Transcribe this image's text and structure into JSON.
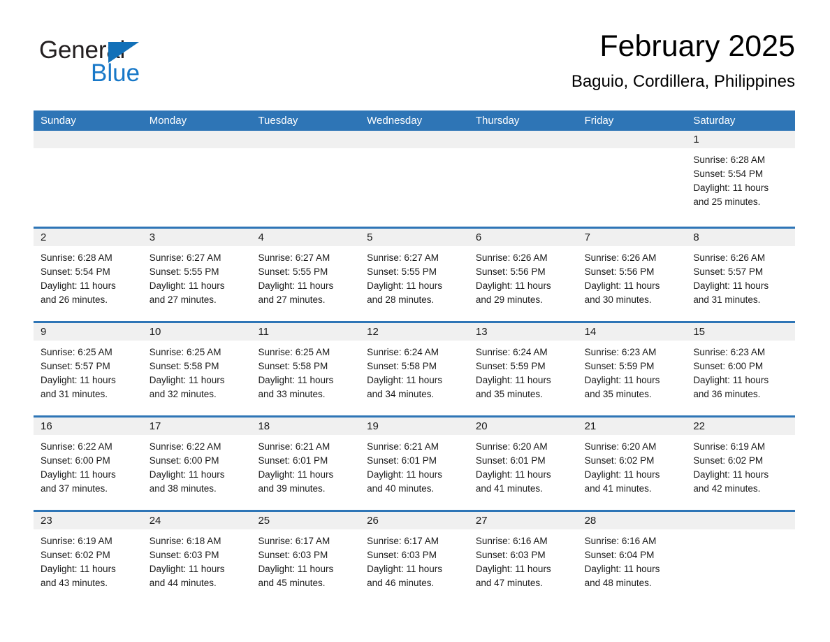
{
  "brand": {
    "name_part1": "General",
    "name_part2": "Blue",
    "logo_icon": "general-blue-triangle-logo"
  },
  "header": {
    "month_title": "February 2025",
    "location": "Baguio, Cordillera, Philippines"
  },
  "colors": {
    "header_blue": "#2e75b6",
    "brand_blue": "#1878c8",
    "day_number_band": "#f0f0f0",
    "text": "#1a1a1a"
  },
  "calendar": {
    "weekday_headers": [
      "Sunday",
      "Monday",
      "Tuesday",
      "Wednesday",
      "Thursday",
      "Friday",
      "Saturday"
    ],
    "weeks": [
      [
        {
          "day": "",
          "sunrise": "",
          "sunset": "",
          "daylight_line1": "",
          "daylight_line2": ""
        },
        {
          "day": "",
          "sunrise": "",
          "sunset": "",
          "daylight_line1": "",
          "daylight_line2": ""
        },
        {
          "day": "",
          "sunrise": "",
          "sunset": "",
          "daylight_line1": "",
          "daylight_line2": ""
        },
        {
          "day": "",
          "sunrise": "",
          "sunset": "",
          "daylight_line1": "",
          "daylight_line2": ""
        },
        {
          "day": "",
          "sunrise": "",
          "sunset": "",
          "daylight_line1": "",
          "daylight_line2": ""
        },
        {
          "day": "",
          "sunrise": "",
          "sunset": "",
          "daylight_line1": "",
          "daylight_line2": ""
        },
        {
          "day": "1",
          "sunrise": "Sunrise: 6:28 AM",
          "sunset": "Sunset: 5:54 PM",
          "daylight_line1": "Daylight: 11 hours",
          "daylight_line2": "and 25 minutes."
        }
      ],
      [
        {
          "day": "2",
          "sunrise": "Sunrise: 6:28 AM",
          "sunset": "Sunset: 5:54 PM",
          "daylight_line1": "Daylight: 11 hours",
          "daylight_line2": "and 26 minutes."
        },
        {
          "day": "3",
          "sunrise": "Sunrise: 6:27 AM",
          "sunset": "Sunset: 5:55 PM",
          "daylight_line1": "Daylight: 11 hours",
          "daylight_line2": "and 27 minutes."
        },
        {
          "day": "4",
          "sunrise": "Sunrise: 6:27 AM",
          "sunset": "Sunset: 5:55 PM",
          "daylight_line1": "Daylight: 11 hours",
          "daylight_line2": "and 27 minutes."
        },
        {
          "day": "5",
          "sunrise": "Sunrise: 6:27 AM",
          "sunset": "Sunset: 5:55 PM",
          "daylight_line1": "Daylight: 11 hours",
          "daylight_line2": "and 28 minutes."
        },
        {
          "day": "6",
          "sunrise": "Sunrise: 6:26 AM",
          "sunset": "Sunset: 5:56 PM",
          "daylight_line1": "Daylight: 11 hours",
          "daylight_line2": "and 29 minutes."
        },
        {
          "day": "7",
          "sunrise": "Sunrise: 6:26 AM",
          "sunset": "Sunset: 5:56 PM",
          "daylight_line1": "Daylight: 11 hours",
          "daylight_line2": "and 30 minutes."
        },
        {
          "day": "8",
          "sunrise": "Sunrise: 6:26 AM",
          "sunset": "Sunset: 5:57 PM",
          "daylight_line1": "Daylight: 11 hours",
          "daylight_line2": "and 31 minutes."
        }
      ],
      [
        {
          "day": "9",
          "sunrise": "Sunrise: 6:25 AM",
          "sunset": "Sunset: 5:57 PM",
          "daylight_line1": "Daylight: 11 hours",
          "daylight_line2": "and 31 minutes."
        },
        {
          "day": "10",
          "sunrise": "Sunrise: 6:25 AM",
          "sunset": "Sunset: 5:58 PM",
          "daylight_line1": "Daylight: 11 hours",
          "daylight_line2": "and 32 minutes."
        },
        {
          "day": "11",
          "sunrise": "Sunrise: 6:25 AM",
          "sunset": "Sunset: 5:58 PM",
          "daylight_line1": "Daylight: 11 hours",
          "daylight_line2": "and 33 minutes."
        },
        {
          "day": "12",
          "sunrise": "Sunrise: 6:24 AM",
          "sunset": "Sunset: 5:58 PM",
          "daylight_line1": "Daylight: 11 hours",
          "daylight_line2": "and 34 minutes."
        },
        {
          "day": "13",
          "sunrise": "Sunrise: 6:24 AM",
          "sunset": "Sunset: 5:59 PM",
          "daylight_line1": "Daylight: 11 hours",
          "daylight_line2": "and 35 minutes."
        },
        {
          "day": "14",
          "sunrise": "Sunrise: 6:23 AM",
          "sunset": "Sunset: 5:59 PM",
          "daylight_line1": "Daylight: 11 hours",
          "daylight_line2": "and 35 minutes."
        },
        {
          "day": "15",
          "sunrise": "Sunrise: 6:23 AM",
          "sunset": "Sunset: 6:00 PM",
          "daylight_line1": "Daylight: 11 hours",
          "daylight_line2": "and 36 minutes."
        }
      ],
      [
        {
          "day": "16",
          "sunrise": "Sunrise: 6:22 AM",
          "sunset": "Sunset: 6:00 PM",
          "daylight_line1": "Daylight: 11 hours",
          "daylight_line2": "and 37 minutes."
        },
        {
          "day": "17",
          "sunrise": "Sunrise: 6:22 AM",
          "sunset": "Sunset: 6:00 PM",
          "daylight_line1": "Daylight: 11 hours",
          "daylight_line2": "and 38 minutes."
        },
        {
          "day": "18",
          "sunrise": "Sunrise: 6:21 AM",
          "sunset": "Sunset: 6:01 PM",
          "daylight_line1": "Daylight: 11 hours",
          "daylight_line2": "and 39 minutes."
        },
        {
          "day": "19",
          "sunrise": "Sunrise: 6:21 AM",
          "sunset": "Sunset: 6:01 PM",
          "daylight_line1": "Daylight: 11 hours",
          "daylight_line2": "and 40 minutes."
        },
        {
          "day": "20",
          "sunrise": "Sunrise: 6:20 AM",
          "sunset": "Sunset: 6:01 PM",
          "daylight_line1": "Daylight: 11 hours",
          "daylight_line2": "and 41 minutes."
        },
        {
          "day": "21",
          "sunrise": "Sunrise: 6:20 AM",
          "sunset": "Sunset: 6:02 PM",
          "daylight_line1": "Daylight: 11 hours",
          "daylight_line2": "and 41 minutes."
        },
        {
          "day": "22",
          "sunrise": "Sunrise: 6:19 AM",
          "sunset": "Sunset: 6:02 PM",
          "daylight_line1": "Daylight: 11 hours",
          "daylight_line2": "and 42 minutes."
        }
      ],
      [
        {
          "day": "23",
          "sunrise": "Sunrise: 6:19 AM",
          "sunset": "Sunset: 6:02 PM",
          "daylight_line1": "Daylight: 11 hours",
          "daylight_line2": "and 43 minutes."
        },
        {
          "day": "24",
          "sunrise": "Sunrise: 6:18 AM",
          "sunset": "Sunset: 6:03 PM",
          "daylight_line1": "Daylight: 11 hours",
          "daylight_line2": "and 44 minutes."
        },
        {
          "day": "25",
          "sunrise": "Sunrise: 6:17 AM",
          "sunset": "Sunset: 6:03 PM",
          "daylight_line1": "Daylight: 11 hours",
          "daylight_line2": "and 45 minutes."
        },
        {
          "day": "26",
          "sunrise": "Sunrise: 6:17 AM",
          "sunset": "Sunset: 6:03 PM",
          "daylight_line1": "Daylight: 11 hours",
          "daylight_line2": "and 46 minutes."
        },
        {
          "day": "27",
          "sunrise": "Sunrise: 6:16 AM",
          "sunset": "Sunset: 6:03 PM",
          "daylight_line1": "Daylight: 11 hours",
          "daylight_line2": "and 47 minutes."
        },
        {
          "day": "28",
          "sunrise": "Sunrise: 6:16 AM",
          "sunset": "Sunset: 6:04 PM",
          "daylight_line1": "Daylight: 11 hours",
          "daylight_line2": "and 48 minutes."
        },
        {
          "day": "",
          "sunrise": "",
          "sunset": "",
          "daylight_line1": "",
          "daylight_line2": ""
        }
      ]
    ]
  }
}
